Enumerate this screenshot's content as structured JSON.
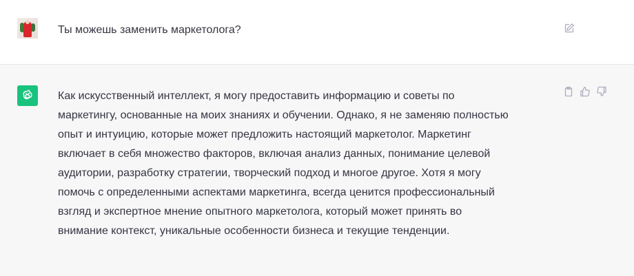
{
  "conversation": {
    "user_message": {
      "text": "Ты можешь заменить маркетолога?",
      "avatar_icon": "user-photo-avatar",
      "edit_icon": "edit-icon"
    },
    "assistant_message": {
      "avatar_icon": "chatgpt-logo-icon",
      "avatar_color": "#19c37d",
      "lines": [
        "Как искусственный интеллект, я могу предоставить информацию и советы по",
        "маркетингу, основанные на моих знаниях и обучении. Однако, я не заменяю полностью",
        "опыт и интуицию, которые может предложить настоящий маркетолог. Маркетинг",
        "включает в себя множество факторов, включая анализ данных, понимание целевой",
        "аудитории, разработку стратегии, творческий подход и многое другое. Хотя я могу",
        "помочь с определенными аспектами маркетинга, всегда ценится профессиональный",
        "взгляд и экспертное мнение опытного маркетолога, который может принять во",
        "внимание контекст, уникальные особенности бизнеса и текущие тенденции."
      ],
      "actions": [
        "copy-icon",
        "thumbs-up-icon",
        "thumbs-down-icon"
      ]
    }
  },
  "colors": {
    "user_row_bg": "#ffffff",
    "assistant_row_bg": "#f7f7f8",
    "text": "#343541",
    "icon": "#acacbe"
  }
}
